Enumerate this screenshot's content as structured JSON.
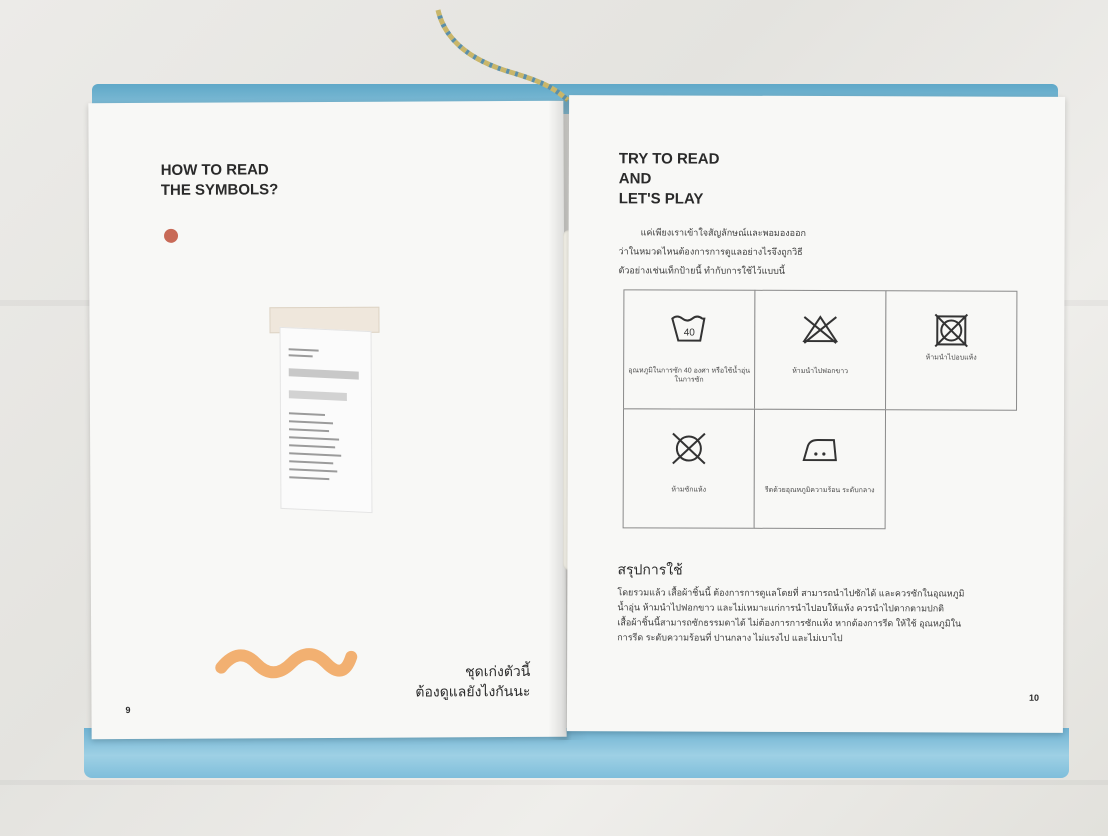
{
  "left_page": {
    "heading": [
      "HOW TO READ",
      "THE SYMBOLS?"
    ],
    "thai_caption": [
      "ชุดเก่งตัวนี้",
      "ต้องดูแลยังไงกันนะ"
    ],
    "page_number": "9"
  },
  "right_page": {
    "heading": [
      "TRY TO READ",
      "AND",
      "LET'S PLAY"
    ],
    "intro": [
      "แค่เพียงเราเข้าใจสัญลักษณ์และพอมองออก",
      "ว่าในหมวดไหนต้องการการดูแลอย่างไรจึงถูกวิธี",
      "ตัวอย่างเช่นเท็กป้ายนี้ ทำกับการใช้ไว้แบบนี้"
    ],
    "symbols": [
      {
        "icon": "wash-40-icon",
        "caption": "อุณหภูมิในการซัก 40 องศา หรือใช้น้ำอุ่นในการซัก"
      },
      {
        "icon": "no-bleach-icon",
        "caption": "ห้ามนำไปฟอกขาว"
      },
      {
        "icon": "no-tumble-dry-icon",
        "caption": "ห้ามนำไปอบแห้ง"
      },
      {
        "icon": "no-dry-clean-icon",
        "caption": "ห้ามซักแห้ง"
      },
      {
        "icon": "iron-medium-icon",
        "caption": "รีดด้วยอุณหภูมิความร้อน ระดับกลาง"
      }
    ],
    "wash_temp": "40",
    "summary_heading": "สรุปการใช้",
    "summary": [
      "โดยรวมแล้ว เสื้อผ้าชิ้นนี้ ต้องการการดูแลโดยที่ สามารถนำไปซักได้ และควรซักในอุณหภูมิ",
      "น้ำอุ่น ห้ามนำไปฟอกขาว และไม่เหมาะแก่การนำไปอบให้แห้ง ควรนำไปตากตามปกติ",
      "เสื้อผ้าชิ้นนี้สามารถซักธรรมดาได้ ไม่ต้องการการซักแห้ง หากต้องการรีด ให้ใช้ อุณหภูมิใน",
      "การรีด ระดับความร้อนที่ ปานกลาง ไม่แรงไป และไม่เบาไป"
    ],
    "page_number": "10"
  },
  "colors": {
    "cover_blue": "#6fb2d2",
    "dot_red": "#c86a57",
    "squiggle_orange": "#f2b071"
  }
}
